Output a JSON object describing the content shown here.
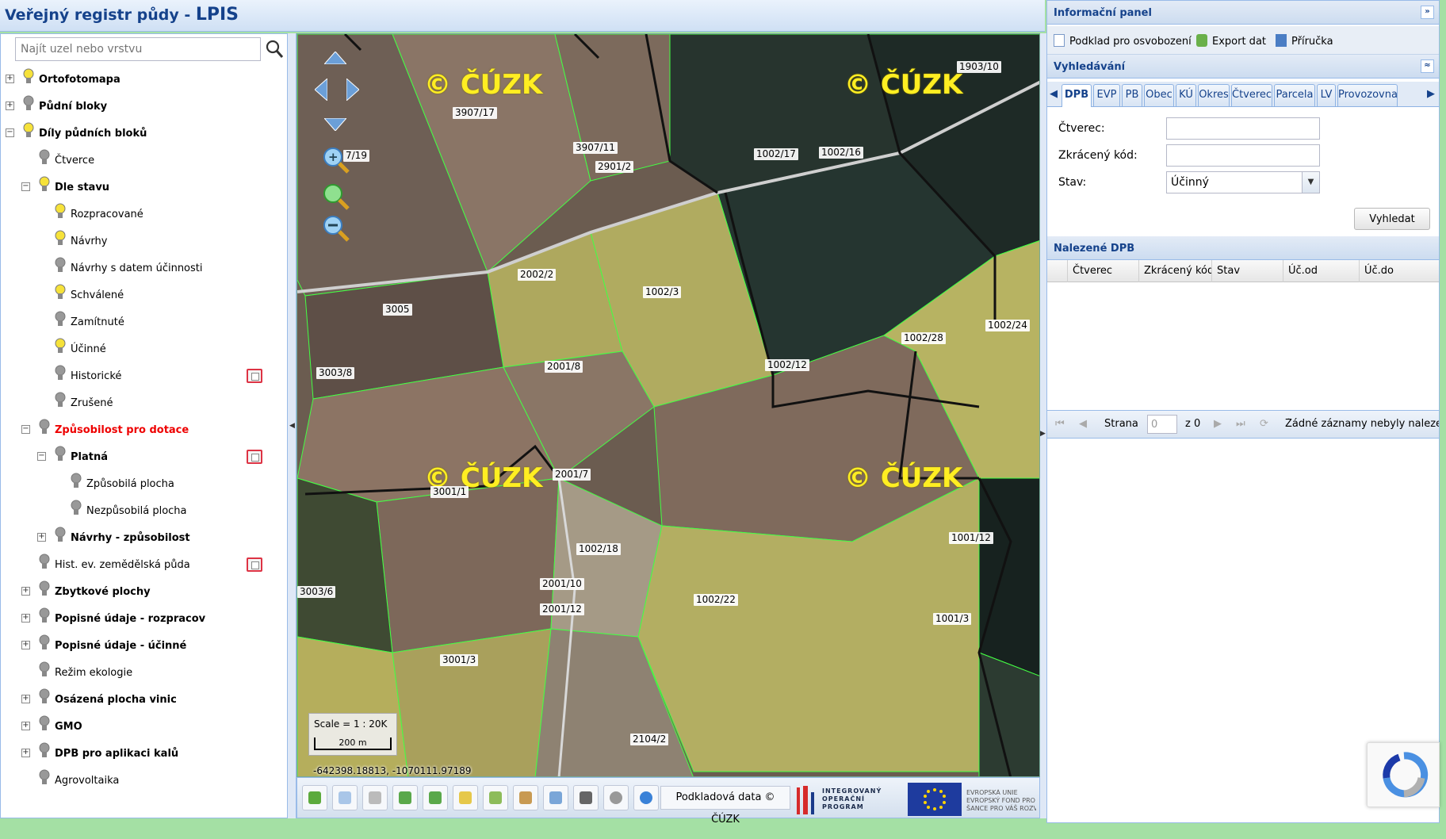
{
  "app": {
    "title_prefix": "Veřejný registr půdy - ",
    "title_brand": "LPIS"
  },
  "tree_search": {
    "placeholder": "Najít uzel nebo vrstvu"
  },
  "tree": [
    {
      "label": "Ortofotomapa",
      "depth": 0,
      "toggle": "+",
      "bulb": "on",
      "style": "bold"
    },
    {
      "label": "Půdní bloky",
      "depth": 0,
      "toggle": "+",
      "bulb": "off",
      "style": "bold"
    },
    {
      "label": "Díly půdních bloků",
      "depth": 0,
      "toggle": "-",
      "bulb": "on",
      "style": "bold"
    },
    {
      "label": "Čtverce",
      "depth": 1,
      "toggle": "",
      "bulb": "off",
      "style": ""
    },
    {
      "label": "Dle stavu",
      "depth": 1,
      "toggle": "-",
      "bulb": "on",
      "style": "bold"
    },
    {
      "label": "Rozpracované",
      "depth": 2,
      "toggle": "",
      "bulb": "on",
      "style": ""
    },
    {
      "label": "Návrhy",
      "depth": 2,
      "toggle": "",
      "bulb": "on",
      "style": ""
    },
    {
      "label": "Návrhy s datem účinnosti",
      "depth": 2,
      "toggle": "",
      "bulb": "off",
      "style": ""
    },
    {
      "label": "Schválené",
      "depth": 2,
      "toggle": "",
      "bulb": "on",
      "style": ""
    },
    {
      "label": "Zamítnuté",
      "depth": 2,
      "toggle": "",
      "bulb": "off",
      "style": ""
    },
    {
      "label": "Účinné",
      "depth": 2,
      "toggle": "",
      "bulb": "on",
      "style": ""
    },
    {
      "label": "Historické",
      "depth": 2,
      "toggle": "",
      "bulb": "off",
      "style": "",
      "legend": true
    },
    {
      "label": "Zrušené",
      "depth": 2,
      "toggle": "",
      "bulb": "off",
      "style": ""
    },
    {
      "label": "Způsobilost pro dotace",
      "depth": 1,
      "toggle": "-",
      "bulb": "off",
      "style": "red"
    },
    {
      "label": "Platná",
      "depth": 2,
      "toggle": "-",
      "bulb": "off",
      "style": "bold",
      "legend": true
    },
    {
      "label": "Způsobilá plocha",
      "depth": 3,
      "toggle": "",
      "bulb": "off",
      "style": ""
    },
    {
      "label": "Nezpůsobilá plocha",
      "depth": 3,
      "toggle": "",
      "bulb": "off",
      "style": ""
    },
    {
      "label": "Návrhy - způsobilost",
      "depth": 2,
      "toggle": "+",
      "bulb": "off",
      "style": "bold"
    },
    {
      "label": "Hist. ev. zemědělská půda",
      "depth": 1,
      "toggle": "",
      "bulb": "off",
      "style": "",
      "legend": true
    },
    {
      "label": "Zbytkové plochy",
      "depth": 1,
      "toggle": "+",
      "bulb": "off",
      "style": "bold"
    },
    {
      "label": "Popisné údaje - rozpracov",
      "depth": 1,
      "toggle": "+",
      "bulb": "off",
      "style": "bold"
    },
    {
      "label": "Popisné údaje - účinné",
      "depth": 1,
      "toggle": "+",
      "bulb": "off",
      "style": "bold"
    },
    {
      "label": "Režim ekologie",
      "depth": 1,
      "toggle": "",
      "bulb": "off",
      "style": ""
    },
    {
      "label": "Osázená plocha vinic",
      "depth": 1,
      "toggle": "+",
      "bulb": "off",
      "style": "bold"
    },
    {
      "label": "GMO",
      "depth": 1,
      "toggle": "+",
      "bulb": "off",
      "style": "bold"
    },
    {
      "label": "DPB pro aplikaci kalů",
      "depth": 1,
      "toggle": "+",
      "bulb": "off",
      "style": "bold"
    },
    {
      "label": "Agrovoltaika",
      "depth": 1,
      "toggle": "",
      "bulb": "off",
      "style": ""
    }
  ],
  "map": {
    "watermark": "© ČÚZK",
    "parcels": [
      "3907/17",
      "3907/11",
      "2901/2",
      "1002/17",
      "1002/16",
      "1903/10",
      "2002/2",
      "1002/3",
      "3005",
      "1002/12",
      "1002/28",
      "1002/24",
      "3003/8",
      "2001/8",
      "3001/1",
      "2001/7",
      "1002/18",
      "2001/10",
      "2001/12",
      "1001/12",
      "3003/6",
      "1002/22",
      "3001/3",
      "1001/3",
      "2104/2",
      "7/19"
    ],
    "scale_text": "Scale = 1 : 20K",
    "scale_bar": "200 m",
    "coords": "-642398.18813, -1070111.97189",
    "podklad_label": "Podkladová data © ČÚZK",
    "iop_logo": [
      "INTEGROVANÝ",
      "OPERAČNÍ",
      "PROGRAM"
    ],
    "eu_logo": [
      "EVROPSKÁ UNIE",
      "EVROPSKÝ FOND PRO REG",
      "ŠANCE PRO VÁŠ ROZVOJ"
    ]
  },
  "info": {
    "title": "Informační panel",
    "collapse": "»",
    "actions": [
      "Podklad pro osvobození",
      "Export dat",
      "Příručka"
    ],
    "search_title": "Vyhledávání",
    "search_ctl": "≈",
    "tabs": [
      "DPB",
      "EVP",
      "PB",
      "Obec",
      "KÚ",
      "Okres",
      "Čtverec",
      "Parcela",
      "LV",
      "Provozovna"
    ],
    "active_tab": "DPB",
    "fields": {
      "ctverec": "Čtverec:",
      "kod": "Zkrácený kód:",
      "stav": "Stav:"
    },
    "stav_value": "Účinný",
    "search_button": "Vyhledat",
    "results_title": "Nalezené DPB",
    "columns": [
      "Čtverec",
      "Zkrácený kód.",
      "Stav",
      "Úč.od",
      "Úč.do"
    ],
    "pager": {
      "strana": "Strana",
      "page": "0",
      "of": "z 0",
      "empty": "Žádné záznamy nebyly nalezeny"
    }
  },
  "colors": {
    "header_text": "#15428b",
    "accent_border": "#99bbe8",
    "highlight_red": "#e00000"
  }
}
